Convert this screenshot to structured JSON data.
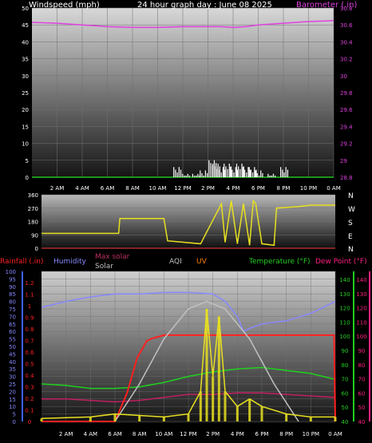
{
  "header": {
    "left": "Windspeed (mph)",
    "center": "24 hour graph day : June 08 2025",
    "right": "Barometer (.in)"
  },
  "bottom_labels": {
    "rainfall": "Rainfall (.in)",
    "humidity": "Humidity",
    "max_solar": "Max solar",
    "solar": "Solar",
    "aqi": "AQI",
    "uv": "UV",
    "temperature": "Temperature (°F)",
    "dewpoint": "Dew Point (°F)"
  },
  "compass": [
    "N",
    "W",
    "S",
    "E",
    "N"
  ],
  "colors": {
    "wind_axis": "#ffffff",
    "baro": "#e040e0",
    "wind_dir": "#e8e020",
    "rain": "#ff2020",
    "humidity": "#8888ff",
    "temp": "#20d020",
    "dew": "#c02060",
    "solar": "#e8e020",
    "maxsolar": "#c0c0c0",
    "uv": "#ff8000"
  },
  "chart_data": [
    {
      "type": "bar",
      "panel": "wind",
      "x_ticks": [
        "2 AM",
        "4 AM",
        "6 AM",
        "8 AM",
        "10 AM",
        "12 PM",
        "2 PM",
        "4 PM",
        "6 PM",
        "8 PM",
        "10 PM",
        "0 AM"
      ],
      "ylim": [
        0,
        50
      ],
      "y_ticks": [
        0,
        5,
        10,
        15,
        20,
        25,
        30,
        35,
        40,
        45,
        50
      ],
      "y2lim": [
        28.8,
        30.8
      ],
      "y2_ticks": [
        "28.8",
        "29",
        "29.2",
        "29.4",
        "29.6",
        "29.8",
        "30",
        "30.2",
        "30.4",
        "30.6",
        "30.8"
      ],
      "barometer": [
        [
          0,
          30.63
        ],
        [
          2,
          30.62
        ],
        [
          4,
          30.6
        ],
        [
          6,
          30.58
        ],
        [
          8,
          30.57
        ],
        [
          10,
          30.57
        ],
        [
          12,
          30.58
        ],
        [
          14,
          30.58
        ],
        [
          15,
          30.58
        ],
        [
          16,
          30.57
        ],
        [
          17,
          30.58
        ],
        [
          18,
          30.6
        ],
        [
          20,
          30.62
        ],
        [
          22,
          30.64
        ],
        [
          24,
          30.65
        ]
      ],
      "wind_gust": [
        [
          11.5,
          3
        ],
        [
          12.2,
          1
        ],
        [
          13,
          1
        ],
        [
          13.6,
          2
        ],
        [
          14.3,
          5
        ],
        [
          14.6,
          4
        ],
        [
          15,
          3
        ],
        [
          15.5,
          4
        ],
        [
          16,
          3
        ],
        [
          16.5,
          4
        ],
        [
          17,
          3
        ],
        [
          17.5,
          3
        ],
        [
          18,
          2
        ],
        [
          19,
          1
        ],
        [
          20,
          3
        ]
      ]
    },
    {
      "type": "line",
      "panel": "wind_direction",
      "ylim": [
        0,
        360
      ],
      "y_ticks": [
        0,
        90,
        180,
        270,
        360
      ],
      "x": [
        0,
        6.3,
        6.4,
        10,
        10.3,
        13,
        14.7,
        15,
        15.5,
        16,
        16.5,
        17,
        17.3,
        17.5,
        18,
        19,
        19.2,
        21,
        22,
        24
      ],
      "values": [
        100,
        100,
        200,
        200,
        50,
        30,
        300,
        40,
        320,
        30,
        300,
        20,
        320,
        300,
        30,
        20,
        270,
        280,
        290,
        290
      ]
    },
    {
      "type": "line",
      "panel": "multi",
      "ylim": [
        0,
        100
      ],
      "y_ticks_humidity": [
        0,
        5,
        10,
        15,
        20,
        25,
        30,
        35,
        40,
        45,
        50,
        55,
        60,
        65,
        70,
        75,
        80,
        85,
        90,
        95,
        100
      ],
      "y_ticks_rain": [
        "0",
        "0.1",
        "0.2",
        "0.3",
        "0.4",
        "0.5",
        "0.6",
        "0.7",
        "0.8",
        "0.9",
        "1",
        "1.1",
        "1.2"
      ],
      "y_ticks_temp": [
        40,
        50,
        60,
        70,
        80,
        90,
        100,
        110,
        120,
        130,
        140
      ],
      "series": [
        {
          "name": "Humidity",
          "x": [
            0,
            2,
            4,
            6,
            8,
            10,
            12,
            14,
            15,
            16,
            16.5,
            17,
            18,
            20,
            22,
            24
          ],
          "values": [
            76,
            80,
            83,
            85,
            85,
            86,
            86,
            85,
            80,
            70,
            60,
            62,
            65,
            67,
            72,
            80
          ]
        },
        {
          "name": "Temperature (°F)",
          "x": [
            0,
            2,
            4,
            6,
            8,
            10,
            12,
            14,
            16,
            18,
            20,
            22,
            24
          ],
          "values": [
            65,
            64,
            62,
            62,
            63,
            66,
            70,
            73,
            75,
            76,
            74,
            72,
            68
          ]
        },
        {
          "name": "Dew Point (°F)",
          "x": [
            0,
            2,
            4,
            6,
            8,
            10,
            12,
            14,
            16,
            18,
            20,
            22,
            24
          ],
          "values": [
            55,
            55,
            54,
            53,
            54,
            56,
            58,
            58,
            59,
            59,
            58,
            57,
            56
          ]
        },
        {
          "name": "Rainfall (.in)",
          "x": [
            0,
            6,
            7,
            7.8,
            8.6,
            9,
            10,
            11,
            23.9,
            24
          ],
          "values": [
            0,
            0,
            0.25,
            0.55,
            0.7,
            0.72,
            0.75,
            0.75,
            0.75,
            0
          ]
        },
        {
          "name": "Max solar",
          "x": [
            6,
            8,
            10,
            12,
            13.5,
            15,
            17,
            19,
            21
          ],
          "values": [
            0,
            25,
            55,
            75,
            80,
            75,
            55,
            25,
            0
          ]
        },
        {
          "name": "Solar",
          "x": [
            0,
            4,
            6,
            8,
            10,
            12,
            13,
            13.5,
            14,
            14.5,
            15,
            16,
            17,
            18,
            20,
            22,
            24
          ],
          "values": [
            2,
            3,
            5,
            4,
            3,
            5,
            20,
            75,
            30,
            70,
            20,
            10,
            15,
            10,
            5,
            3,
            3
          ]
        }
      ]
    }
  ]
}
